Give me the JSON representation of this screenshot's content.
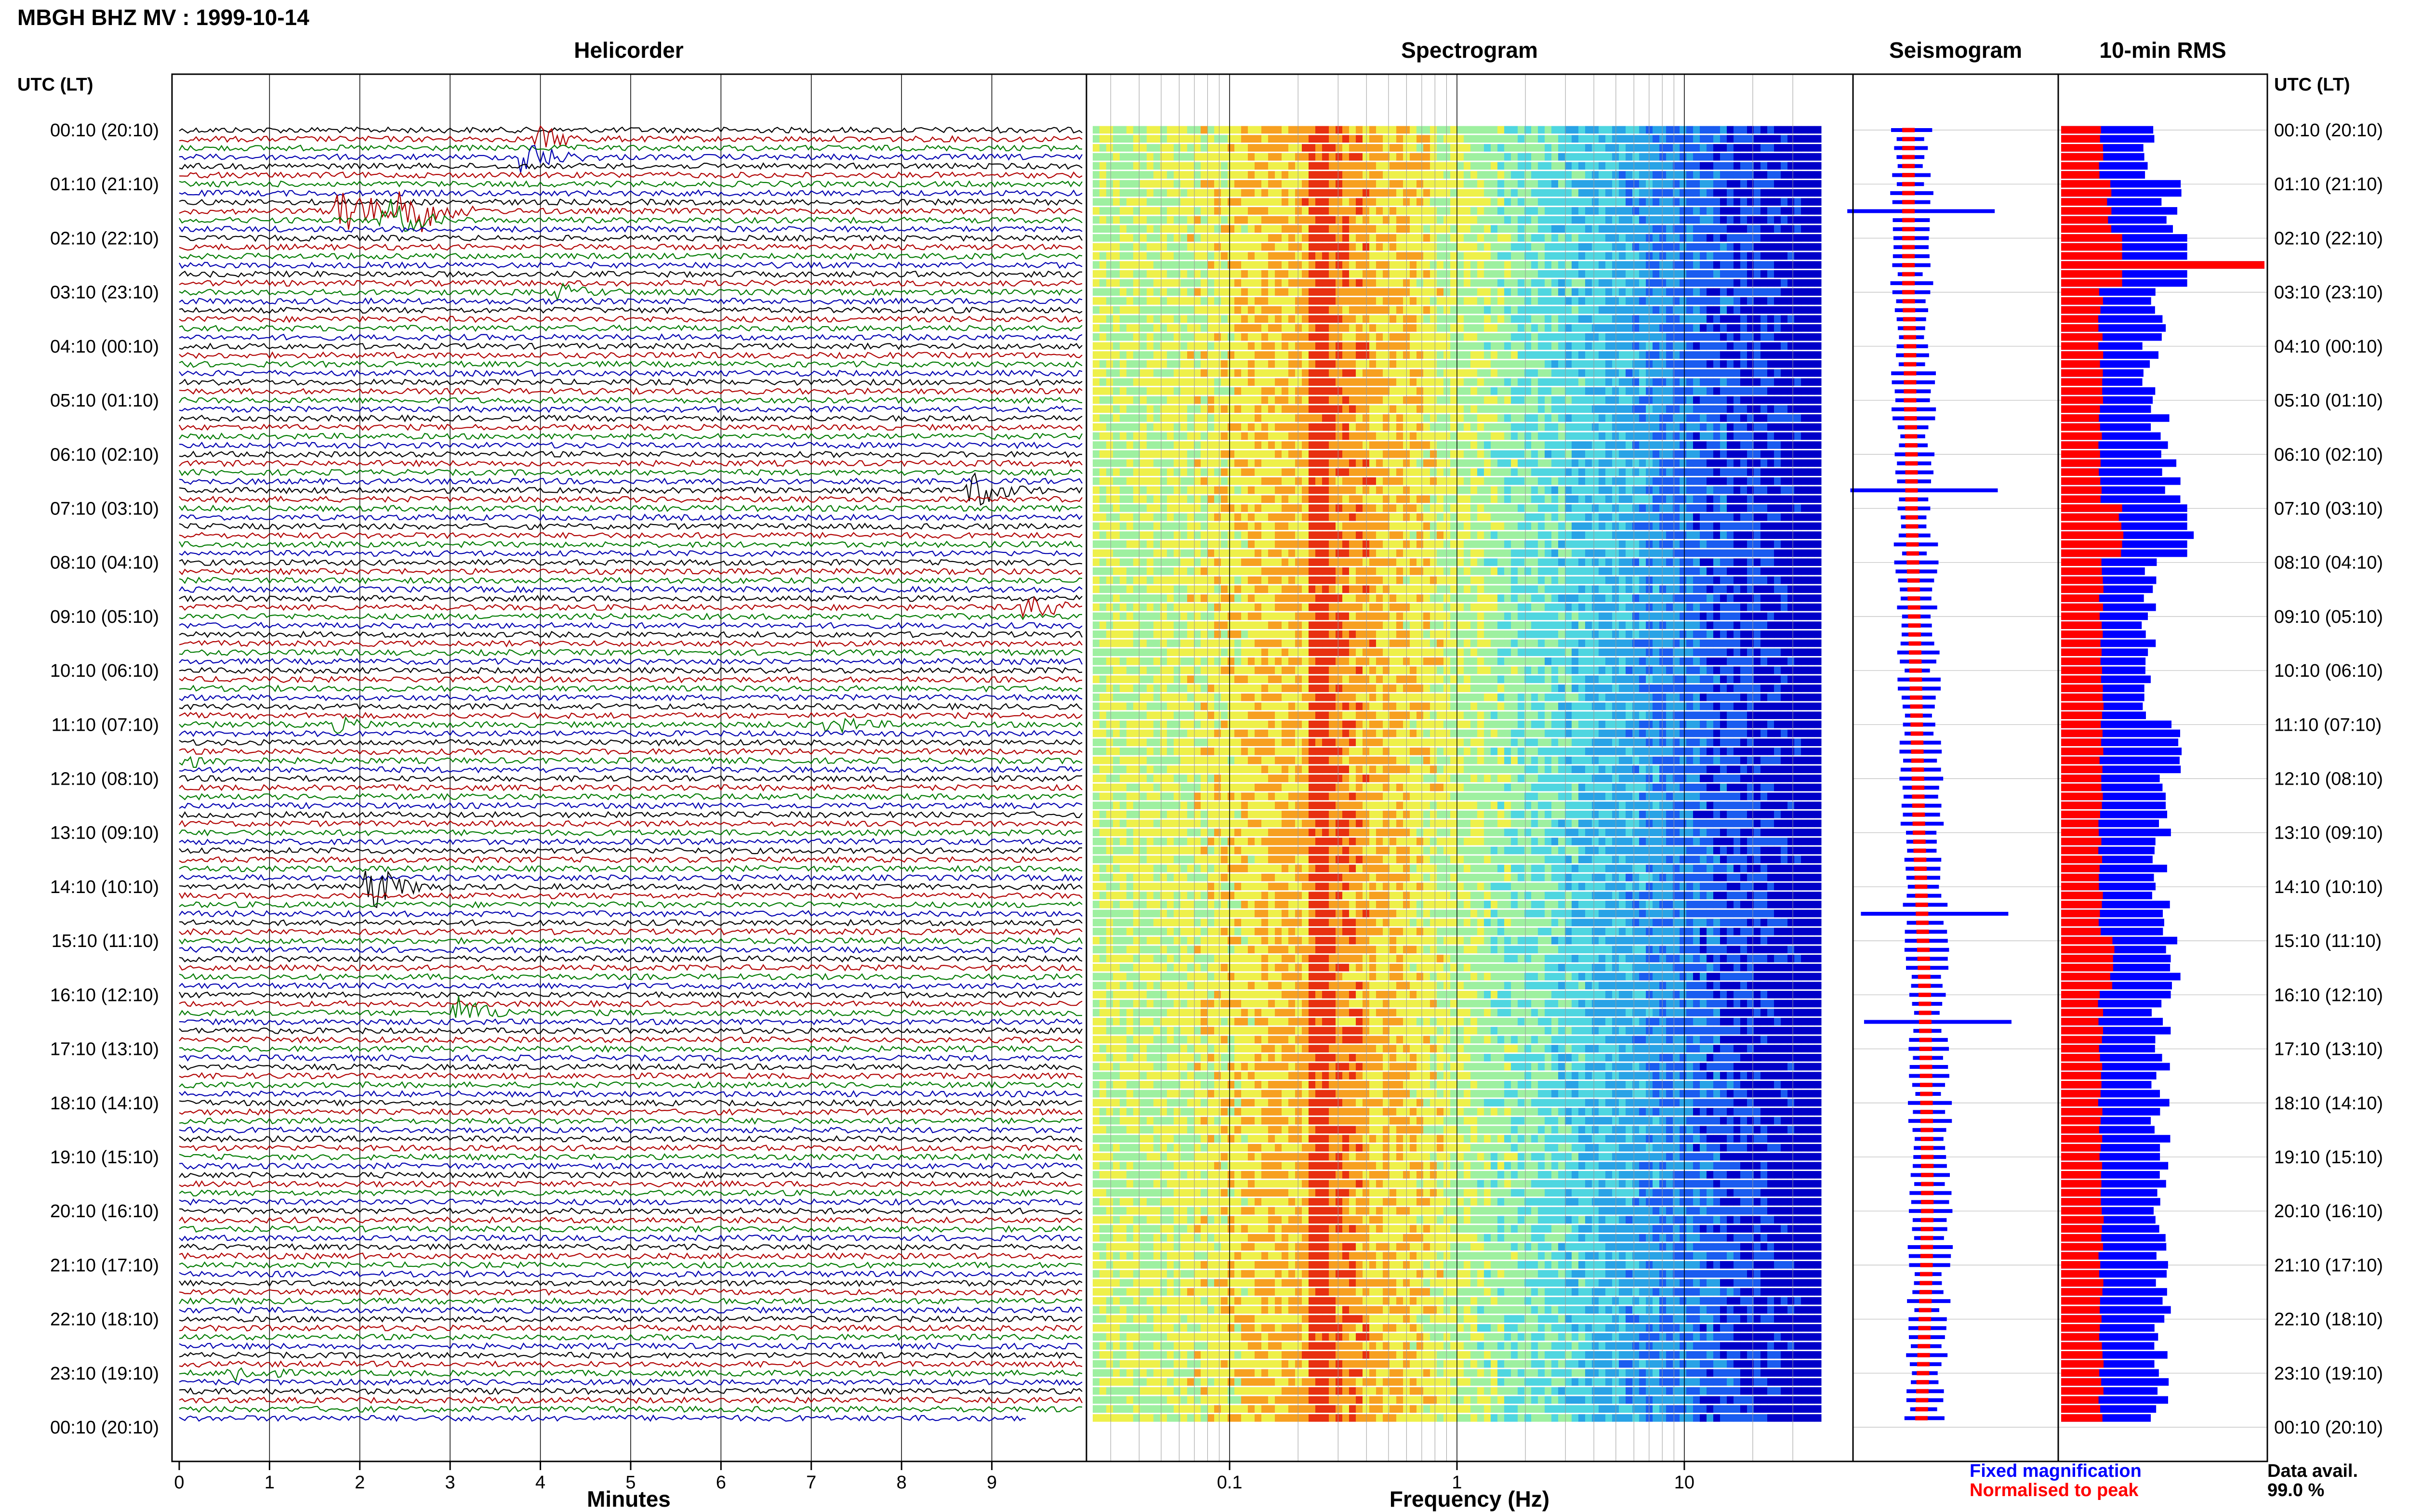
{
  "title": "MBGH BHZ MV : 1999-10-14",
  "time_axis": {
    "header": "UTC (LT)",
    "labels": [
      "00:10 (20:10)",
      "01:10 (21:10)",
      "02:10 (22:10)",
      "03:10 (23:10)",
      "04:10 (00:10)",
      "05:10 (01:10)",
      "06:10 (02:10)",
      "07:10 (03:10)",
      "08:10 (04:10)",
      "09:10 (05:10)",
      "10:10 (06:10)",
      "11:10 (07:10)",
      "12:10 (08:10)",
      "13:10 (09:10)",
      "14:10 (10:10)",
      "15:10 (11:10)",
      "16:10 (12:10)",
      "17:10 (13:10)",
      "18:10 (14:10)",
      "19:10 (15:10)",
      "20:10 (16:10)",
      "21:10 (17:10)",
      "22:10 (18:10)",
      "23:10 (19:10)",
      "00:10 (20:10)"
    ]
  },
  "colors": {
    "trace_cycle": [
      "#000000",
      "#b00000",
      "#007a00",
      "#0000b0"
    ],
    "fixed": "#0000ff",
    "normalised": "#ff0000"
  },
  "chart_data": [
    {
      "type": "line",
      "title": "Helicorder",
      "xlabel": "Minutes",
      "xlim": [
        0,
        10
      ],
      "x_ticks": [
        "0",
        "1",
        "2",
        "3",
        "4",
        "5",
        "6",
        "7",
        "8",
        "9"
      ],
      "row_count": 144,
      "events": [
        {
          "row": 1,
          "minute": 4.0,
          "strength": 0.5
        },
        {
          "row": 3,
          "minute": 3.8,
          "strength": 0.9
        },
        {
          "row": 9,
          "minute": 1.8,
          "strength": 1.6
        },
        {
          "row": 9,
          "minute": 2.5,
          "strength": 1.6
        },
        {
          "row": 10,
          "minute": 2.3,
          "strength": 1.0
        },
        {
          "row": 18,
          "minute": 4.2,
          "strength": 0.3
        },
        {
          "row": 40,
          "minute": 8.8,
          "strength": 0.8
        },
        {
          "row": 53,
          "minute": 9.4,
          "strength": 0.6
        },
        {
          "row": 66,
          "minute": 1.7,
          "strength": 0.3
        },
        {
          "row": 66,
          "minute": 7.2,
          "strength": 0.4
        },
        {
          "row": 70,
          "minute": 0.1,
          "strength": 0.3
        },
        {
          "row": 84,
          "minute": 2.1,
          "strength": 1.2
        },
        {
          "row": 98,
          "minute": 3.1,
          "strength": 0.7
        },
        {
          "row": 138,
          "minute": 0.6,
          "strength": 0.4
        }
      ]
    },
    {
      "type": "heatmap",
      "title": "Spectrogram",
      "xlabel": "Frequency (Hz)",
      "x_scale": "log",
      "xlim": [
        0.025,
        40
      ],
      "x_ticks": [
        "0.1",
        "1",
        "10"
      ],
      "palette": [
        "#0000c8",
        "#1a5cf0",
        "#29a3e6",
        "#4fd6e0",
        "#9ef0a0",
        "#eef04a",
        "#f7a020",
        "#e83010"
      ],
      "peak_frequency_hz": 0.25
    },
    {
      "type": "line",
      "title": "Seismogram",
      "x_scale": "log",
      "xlim": [
        0.025,
        40
      ],
      "fixed_magnification_peak_hz": [
        0.16,
        0.16,
        0.16,
        0.16,
        0.17,
        0.17,
        0.18,
        0.18,
        0.19,
        0.2,
        0.21,
        0.22,
        0.23,
        0.24,
        0.26,
        0.28,
        0.3,
        0.31,
        0.32,
        0.33,
        0.33,
        0.32,
        0.3,
        0.28,
        0.26
      ],
      "spikes_rows": [
        9,
        40,
        87,
        99
      ]
    },
    {
      "type": "bar",
      "title": "10-min RMS",
      "orientation": "horizontal",
      "blue_values": [
        0.45,
        0.55,
        1.6,
        0.5,
        0.45,
        0.5,
        0.55,
        0.7,
        0.45,
        0.45,
        0.45,
        0.6,
        0.5,
        0.5,
        0.5,
        0.55,
        0.5,
        0.5,
        0.5,
        0.5,
        0.5,
        0.5,
        0.5,
        0.5
      ],
      "red_values": [
        0.2,
        0.25,
        1.0,
        0.2,
        0.2,
        0.2,
        0.2,
        0.3,
        0.2,
        0.2,
        0.2,
        0.2,
        0.2,
        0.2,
        0.2,
        0.25,
        0.2,
        0.2,
        0.2,
        0.2,
        0.2,
        0.2,
        0.2,
        0.2
      ],
      "xlim": [
        0,
        1
      ]
    }
  ],
  "legend": {
    "fixed": "Fixed magnification",
    "normalised": "Normalised to peak"
  },
  "data_avail": {
    "label": "Data avail.",
    "value": "99.0 %"
  }
}
